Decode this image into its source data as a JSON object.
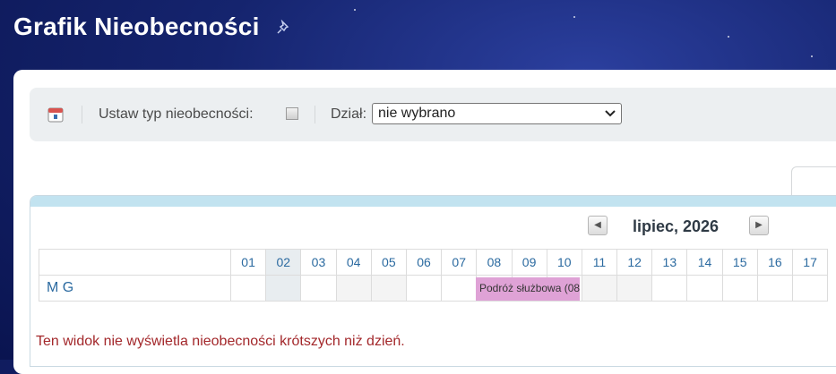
{
  "header": {
    "title": "Grafik Nieobecności",
    "pin_icon": "pin-icon"
  },
  "toolbar": {
    "calendar_icon": "calendar-icon",
    "absence_type_label": "Ustaw typ nieobecności:",
    "absence_type_checked": false,
    "department_label": "Dział:",
    "department_value": "nie wybrano"
  },
  "calendar": {
    "prev_icon": "chevron-left-icon",
    "next_icon": "chevron-right-icon",
    "month_label": "lipiec, 2026",
    "days": [
      "01",
      "02",
      "03",
      "04",
      "05",
      "06",
      "07",
      "08",
      "09",
      "10",
      "11",
      "12",
      "13",
      "14",
      "15",
      "16",
      "17"
    ],
    "rows": [
      {
        "name": "M G",
        "absence": {
          "label": "Podróż służbowa (08"
        }
      }
    ]
  },
  "footer_note": "Ten widok nie wyświetla nieobecności krótszych niż dzień.",
  "colors": {
    "accent_bar": "#c2e3f0",
    "absence": "#dfa2d6",
    "note": "#a3282b"
  }
}
